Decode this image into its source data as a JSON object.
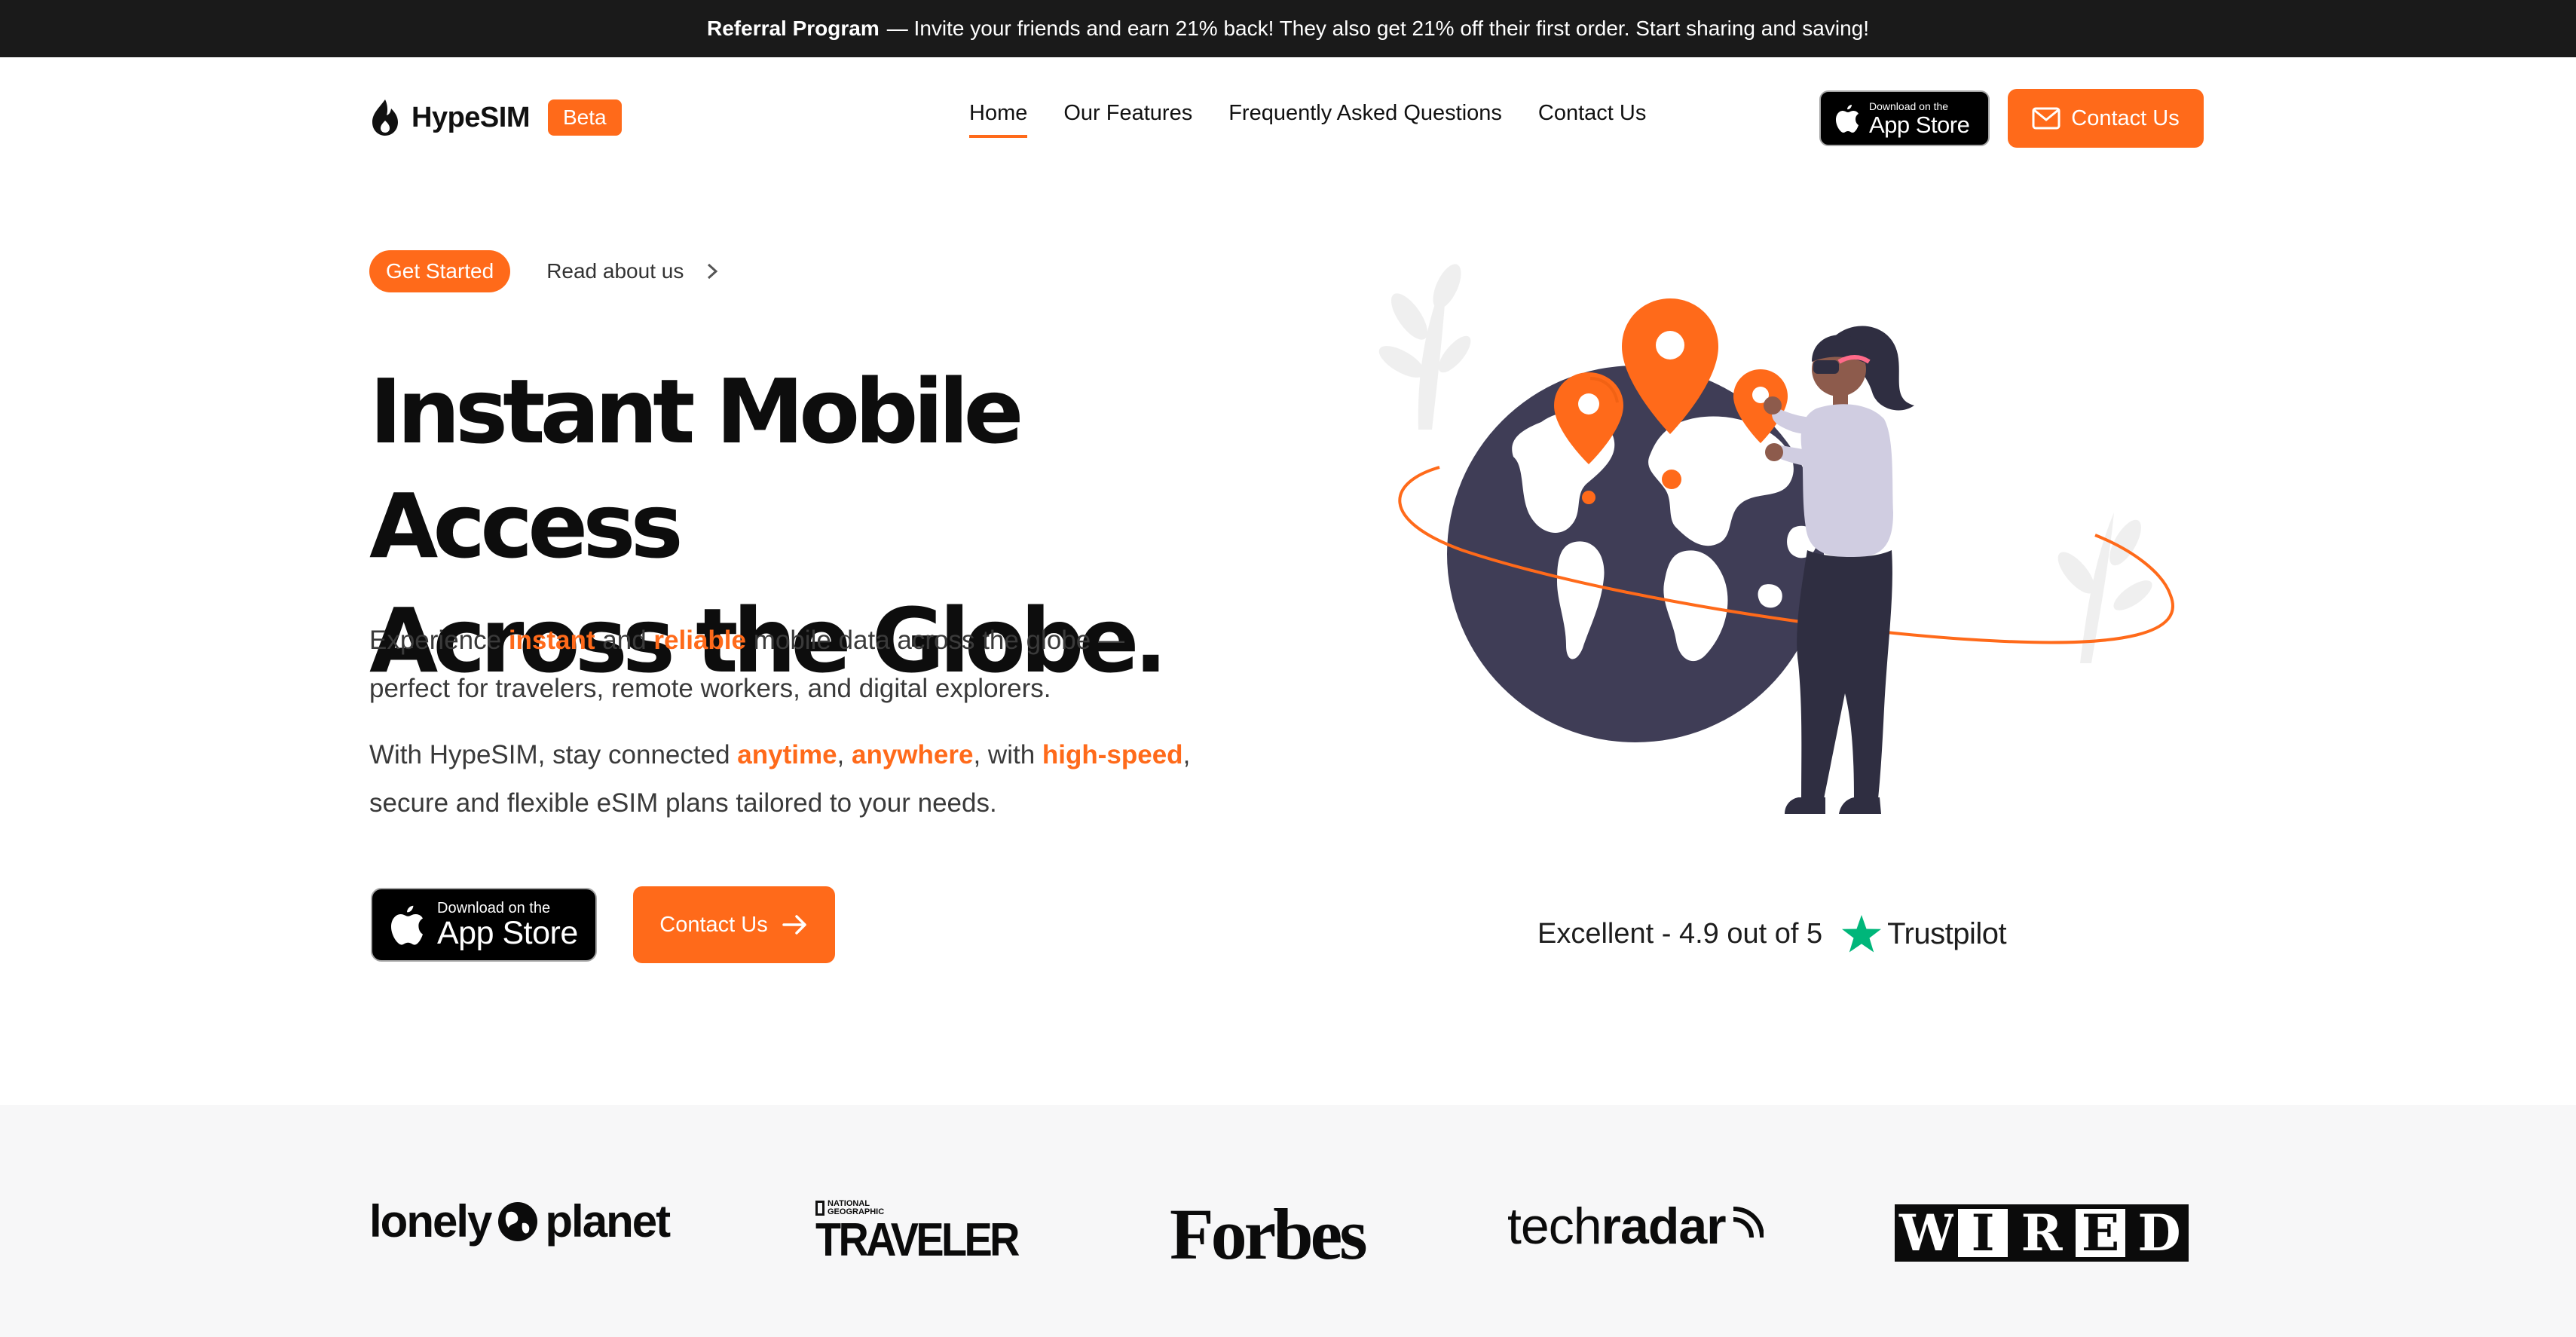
{
  "announcement": {
    "label": "Referral Program",
    "text": "— Invite your friends and earn 21% back! They also get 21% off their first order. Start sharing and saving!"
  },
  "header": {
    "logo_text": "HypeSIM",
    "badge": "Beta",
    "nav": [
      "Home",
      "Our Features",
      "Frequently Asked Questions",
      "Contact Us"
    ],
    "active_nav": "Home",
    "app_store_small": "Download on the",
    "app_store_big": "App Store",
    "contact_label": "Contact Us"
  },
  "hero": {
    "pill_label": "Get Started",
    "read_about": "Read about us",
    "headline_line1": "Instant Mobile Access",
    "headline_line2": "Across the Globe.",
    "para1": {
      "t1": "Experience ",
      "h1": "instant",
      "t2": " and ",
      "h2": "reliable",
      "t3": " mobile data across the globe —",
      "t4": "perfect for travelers, remote workers, and digital explorers."
    },
    "para2": {
      "t1": "With HypeSIM, stay connected ",
      "h1": "anytime",
      "t2": ", ",
      "h2": "anywhere",
      "t3": ", with ",
      "h3": "high-speed",
      "t4": ",",
      "t5": "secure and flexible eSIM plans tailored to your needs."
    },
    "app_store_small": "Download on the",
    "app_store_big": "App Store",
    "contact_label": "Contact Us"
  },
  "trust": {
    "text": "Excellent - 4.9 out of 5",
    "brand": "Trustpilot"
  },
  "press": {
    "lonely_a": "lonely",
    "lonely_b": "planet",
    "ng": "NATIONAL GEOGRAPHIC",
    "traveler": "TRAVELER",
    "forbes": "Forbes",
    "tech": "tech",
    "radar": "radar",
    "wired": [
      "W",
      "I",
      "R",
      "E",
      "D"
    ]
  },
  "colors": {
    "accent": "#ff6a1a",
    "dark": "#1a1a1a",
    "globe": "#3f3d56",
    "trustpilot_green": "#00b67a"
  }
}
